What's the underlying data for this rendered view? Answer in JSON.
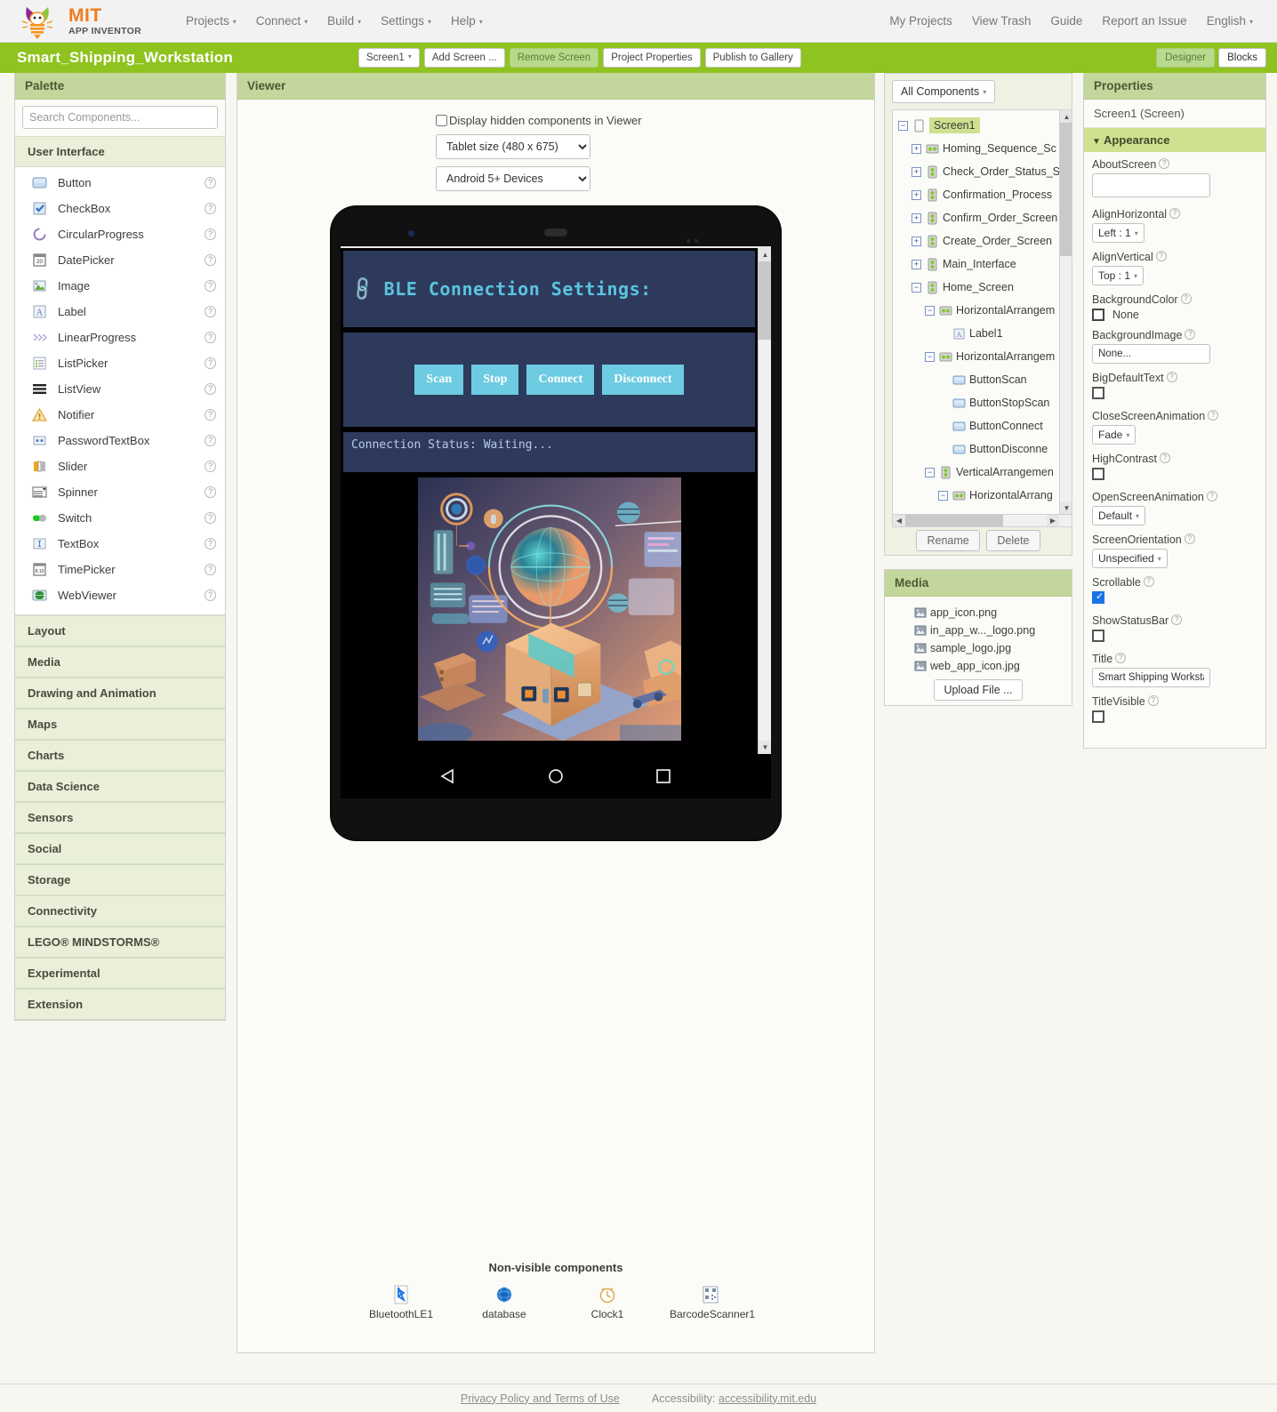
{
  "topnav": {
    "logo": {
      "mit": "MIT",
      "appinventor": "APP INVENTOR",
      "icon": "app-inventor-bee-logo"
    },
    "left_items": [
      {
        "label": "Projects",
        "has_caret": true
      },
      {
        "label": "Connect",
        "has_caret": true
      },
      {
        "label": "Build",
        "has_caret": true
      },
      {
        "label": "Settings",
        "has_caret": true
      },
      {
        "label": "Help",
        "has_caret": true
      }
    ],
    "right_items": [
      {
        "label": "My Projects",
        "has_caret": false
      },
      {
        "label": "View Trash",
        "has_caret": false
      },
      {
        "label": "Guide",
        "has_caret": false
      },
      {
        "label": "Report an Issue",
        "has_caret": false
      },
      {
        "label": "English",
        "has_caret": true
      }
    ]
  },
  "projectbar": {
    "project_name": "Smart_Shipping_Workstation",
    "screen_selector": "Screen1",
    "buttons": [
      {
        "label": "Add Screen ...",
        "disabled": false
      },
      {
        "label": "Remove Screen",
        "disabled": true
      },
      {
        "label": "Project Properties",
        "disabled": false
      },
      {
        "label": "Publish to Gallery",
        "disabled": false
      }
    ],
    "mode_designer": "Designer",
    "mode_blocks": "Blocks",
    "active_mode": "Designer"
  },
  "palette": {
    "title": "Palette",
    "search_placeholder": "Search Components...",
    "search_value": "",
    "open_category": "User Interface",
    "categories": [
      {
        "label": "User Interface",
        "open": true
      },
      {
        "label": "Layout",
        "open": false
      },
      {
        "label": "Media",
        "open": false
      },
      {
        "label": "Drawing and Animation",
        "open": false
      },
      {
        "label": "Maps",
        "open": false
      },
      {
        "label": "Charts",
        "open": false
      },
      {
        "label": "Data Science",
        "open": false
      },
      {
        "label": "Sensors",
        "open": false
      },
      {
        "label": "Social",
        "open": false
      },
      {
        "label": "Storage",
        "open": false
      },
      {
        "label": "Connectivity",
        "open": false
      },
      {
        "label": "LEGO® MINDSTORMS®",
        "open": false
      },
      {
        "label": "Experimental",
        "open": false
      },
      {
        "label": "Extension",
        "open": false
      }
    ],
    "components": [
      {
        "label": "Button",
        "icon": "button-icon",
        "help": "?"
      },
      {
        "label": "CheckBox",
        "icon": "checkbox-icon",
        "help": "?"
      },
      {
        "label": "CircularProgress",
        "icon": "circular-progress-icon",
        "help": "?"
      },
      {
        "label": "DatePicker",
        "icon": "date-picker-icon",
        "help": "?"
      },
      {
        "label": "Image",
        "icon": "image-icon",
        "help": "?"
      },
      {
        "label": "Label",
        "icon": "label-icon",
        "help": "?"
      },
      {
        "label": "LinearProgress",
        "icon": "linear-progress-icon",
        "help": "?"
      },
      {
        "label": "ListPicker",
        "icon": "list-picker-icon",
        "help": "?"
      },
      {
        "label": "ListView",
        "icon": "list-view-icon",
        "help": "?"
      },
      {
        "label": "Notifier",
        "icon": "notifier-icon",
        "help": "?"
      },
      {
        "label": "PasswordTextBox",
        "icon": "password-textbox-icon",
        "help": "?"
      },
      {
        "label": "Slider",
        "icon": "slider-icon",
        "help": "?"
      },
      {
        "label": "Spinner",
        "icon": "spinner-icon",
        "help": "?"
      },
      {
        "label": "Switch",
        "icon": "switch-icon",
        "help": "?"
      },
      {
        "label": "TextBox",
        "icon": "textbox-icon",
        "help": "?"
      },
      {
        "label": "TimePicker",
        "icon": "time-picker-icon",
        "help": "?"
      },
      {
        "label": "WebViewer",
        "icon": "web-viewer-icon",
        "help": "?"
      }
    ]
  },
  "viewer": {
    "title": "Viewer",
    "hidden_components_label": "Display hidden components in Viewer",
    "hidden_components_checked": false,
    "size_select": "Tablet size (480 x 675)",
    "device_select": "Android 5+ Devices",
    "phone_screen": {
      "header_title": "BLE Connection Settings:",
      "header_icon": "chain-link-icon",
      "buttons": [
        "Scan",
        "Stop",
        "Connect",
        "Disconnect"
      ],
      "status_text": "Connection Status: Waiting...",
      "hero_image": "shipping-package-illustration",
      "nav_back": "back-triangle-icon",
      "nav_home": "home-circle-icon",
      "nav_recents": "recents-square-icon"
    },
    "nonvisible": {
      "title": "Non-visible components",
      "items": [
        {
          "label": "BluetoothLE1",
          "icon": "bluetooth-icon"
        },
        {
          "label": "database",
          "icon": "globe-icon"
        },
        {
          "label": "Clock1",
          "icon": "clock-icon"
        },
        {
          "label": "BarcodeScanner1",
          "icon": "barcode-icon"
        }
      ]
    }
  },
  "tree": {
    "filter_label": "All Components",
    "nodes": [
      {
        "label": "Screen1",
        "depth": 0,
        "expander": "minus",
        "icon": "screen-icon",
        "selected": true
      },
      {
        "label": "Homing_Sequence_Sc",
        "depth": 1,
        "expander": "plus",
        "icon": "horizontal-arrangement-icon",
        "selected": false
      },
      {
        "label": "Check_Order_Status_S",
        "depth": 1,
        "expander": "plus",
        "icon": "vertical-arrangement-icon",
        "selected": false
      },
      {
        "label": "Confirmation_Process",
        "depth": 1,
        "expander": "plus",
        "icon": "vertical-arrangement-icon",
        "selected": false
      },
      {
        "label": "Confirm_Order_Screen",
        "depth": 1,
        "expander": "plus",
        "icon": "vertical-arrangement-icon",
        "selected": false
      },
      {
        "label": "Create_Order_Screen",
        "depth": 1,
        "expander": "plus",
        "icon": "vertical-arrangement-icon",
        "selected": false
      },
      {
        "label": "Main_Interface",
        "depth": 1,
        "expander": "plus",
        "icon": "vertical-arrangement-icon",
        "selected": false
      },
      {
        "label": "Home_Screen",
        "depth": 1,
        "expander": "minus",
        "icon": "vertical-arrangement-icon",
        "selected": false
      },
      {
        "label": "HorizontalArrangem",
        "depth": 2,
        "expander": "minus",
        "icon": "horizontal-arrangement-icon",
        "selected": false
      },
      {
        "label": "Label1",
        "depth": 3,
        "expander": "blank",
        "icon": "label-icon",
        "selected": false
      },
      {
        "label": "HorizontalArrangem",
        "depth": 2,
        "expander": "minus",
        "icon": "horizontal-arrangement-icon",
        "selected": false
      },
      {
        "label": "ButtonScan",
        "depth": 3,
        "expander": "blank",
        "icon": "button-icon",
        "selected": false
      },
      {
        "label": "ButtonStopScan",
        "depth": 3,
        "expander": "blank",
        "icon": "button-icon",
        "selected": false
      },
      {
        "label": "ButtonConnect",
        "depth": 3,
        "expander": "blank",
        "icon": "button-icon",
        "selected": false
      },
      {
        "label": "ButtonDisconne",
        "depth": 3,
        "expander": "blank",
        "icon": "button-icon",
        "selected": false
      },
      {
        "label": "VerticalArrangemen",
        "depth": 2,
        "expander": "minus",
        "icon": "vertical-arrangement-icon",
        "selected": false
      },
      {
        "label": "HorizontalArrang",
        "depth": 3,
        "expander": "minus",
        "icon": "horizontal-arrangement-icon",
        "selected": false
      }
    ],
    "rename_label": "Rename",
    "delete_label": "Delete"
  },
  "media": {
    "title": "Media",
    "files": [
      {
        "name": "app_icon.png",
        "icon": "image-file-icon"
      },
      {
        "name": "in_app_w..._logo.png",
        "icon": "image-file-icon"
      },
      {
        "name": "sample_logo.jpg",
        "icon": "image-file-icon"
      },
      {
        "name": "web_app_icon.jpg",
        "icon": "image-file-icon"
      }
    ],
    "upload_label": "Upload File ..."
  },
  "properties": {
    "title": "Properties",
    "target": "Screen1 (Screen)",
    "section": "Appearance",
    "items": [
      {
        "name": "AboutScreen",
        "type": "textarea",
        "value": ""
      },
      {
        "name": "AlignHorizontal",
        "type": "select",
        "value": "Left : 1"
      },
      {
        "name": "AlignVertical",
        "type": "select",
        "value": "Top : 1"
      },
      {
        "name": "BackgroundColor",
        "type": "color",
        "value": "None"
      },
      {
        "name": "BackgroundImage",
        "type": "text",
        "value": "None..."
      },
      {
        "name": "BigDefaultText",
        "type": "checkbox",
        "checked": false
      },
      {
        "name": "CloseScreenAnimation",
        "type": "select",
        "value": "Fade"
      },
      {
        "name": "HighContrast",
        "type": "checkbox",
        "checked": false
      },
      {
        "name": "OpenScreenAnimation",
        "type": "select",
        "value": "Default"
      },
      {
        "name": "ScreenOrientation",
        "type": "select",
        "value": "Unspecified"
      },
      {
        "name": "Scrollable",
        "type": "checkbox",
        "checked": true
      },
      {
        "name": "ShowStatusBar",
        "type": "checkbox",
        "checked": false
      },
      {
        "name": "Title",
        "type": "text",
        "value": "Smart Shipping Workstation"
      },
      {
        "name": "TitleVisible",
        "type": "checkbox",
        "checked": false
      }
    ]
  },
  "footer": {
    "privacy": "Privacy Policy and Terms of Use",
    "accessibility_label": "Accessibility:",
    "accessibility_link": "accessibility.mit.edu"
  },
  "colors": {
    "brand_green": "#8fc31f",
    "panel_green": "#c3d69b",
    "section_green": "#cfe08f",
    "orange": "#f07c1d",
    "phone_bg": "#2e3a5c",
    "ble_cyan": "#5bc4e0",
    "button_cyan": "#6dcbe2"
  }
}
